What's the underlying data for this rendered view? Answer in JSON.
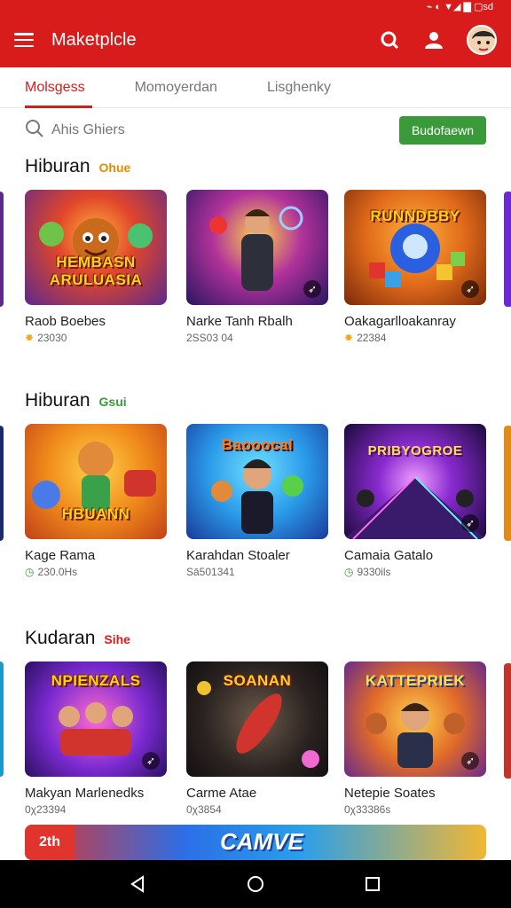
{
  "status": {
    "right_text": "⌁ ◐ ▼◢ ▇ ▢sd"
  },
  "appbar": {
    "title": "Maketplcle",
    "icons": [
      "menu-icon",
      "search-icon",
      "person-icon",
      "avatar"
    ]
  },
  "tabs": [
    {
      "label": "Molsgess",
      "active": true
    },
    {
      "label": "Momoyerdan",
      "active": false
    },
    {
      "label": "Lisghenky",
      "active": false
    }
  ],
  "search": {
    "placeholder": "Ahis Ghiers",
    "button_label": "Budofaewn"
  },
  "sections": [
    {
      "title": "Hiburan",
      "tag": "Ohue",
      "tag_color": "#e38b00",
      "cards": [
        {
          "title": "Raob Boebes",
          "meta": "23030",
          "meta_icon": "star-icon",
          "art_text": "HEMBASN ARULUASIA"
        },
        {
          "title": "Narke Tanh Rbalh",
          "meta": "2SS03 04",
          "meta_icon": "",
          "art_text": ""
        },
        {
          "title": "Oakagarlloakanray",
          "meta": "22384",
          "meta_icon": "star-icon",
          "art_text": "RUNNDBBY"
        }
      ]
    },
    {
      "title": "Hiburan",
      "tag": "Gsui",
      "tag_color": "#3a9a3a",
      "cards": [
        {
          "title": "Kage Rama",
          "meta": "230.0Hs",
          "meta_icon": "clock-icon",
          "art_text": "HBUANN"
        },
        {
          "title": "Karahdan Stoaler",
          "meta": "Sā501341",
          "meta_icon": "",
          "art_text": "Baooocal"
        },
        {
          "title": "Camaia Gatalo",
          "meta": "9330ils",
          "meta_icon": "clock-icon",
          "art_text": "PRIBYOGROE"
        }
      ]
    },
    {
      "title": "Kudaran",
      "tag": "Sihe",
      "tag_color": "#d81b1b",
      "cards": [
        {
          "title": "Makyan Marlenedks",
          "meta": "0χ23394",
          "meta_icon": "",
          "art_text": "NPIENZALS"
        },
        {
          "title": "Carme Atae",
          "meta": "0χ3854",
          "meta_icon": "",
          "art_text": "SOANAN"
        },
        {
          "title": "Netepie Soates",
          "meta": "0χ33386s",
          "meta_icon": "",
          "art_text": "KATTEPRIEK"
        }
      ]
    }
  ],
  "banner": {
    "left_text": "2th",
    "text": "CAMVE"
  },
  "navbar": {
    "buttons": [
      "back-icon",
      "home-icon",
      "recents-icon"
    ]
  },
  "colors": {
    "brand": "#d81b1b",
    "accent": "#3a9a3a"
  }
}
